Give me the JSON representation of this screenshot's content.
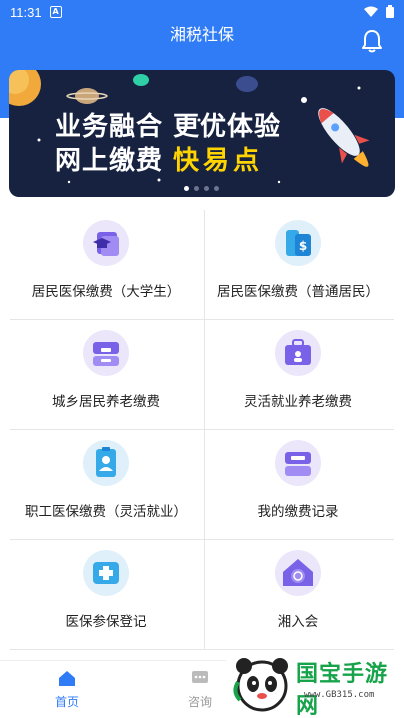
{
  "status_bar": {
    "time": "11:31",
    "notification_badge": "A"
  },
  "app_bar": {
    "title": "湘税社保",
    "bell_icon": "bell-icon"
  },
  "banner": {
    "line1": "业务融合 更优体验",
    "line2_prefix": "网上缴费",
    "line2_highlight": "快易点",
    "indicator_count": 4,
    "indicator_active": 0
  },
  "services": [
    {
      "label": "居民医保缴费（大学生）",
      "icon": "graduation-card-icon"
    },
    {
      "label": "居民医保缴费（普通居民）",
      "icon": "building-payment-icon"
    },
    {
      "label": "城乡居民养老缴费",
      "icon": "cabinet-icon"
    },
    {
      "label": "灵活就业养老缴费",
      "icon": "briefcase-icon"
    },
    {
      "label": "职工医保缴费（灵活就业）",
      "icon": "badge-person-icon"
    },
    {
      "label": "我的缴费记录",
      "icon": "record-box-icon"
    },
    {
      "label": "医保参保登记",
      "icon": "medical-plus-icon"
    },
    {
      "label": "湘入会",
      "icon": "house-icon"
    }
  ],
  "bottom_nav": {
    "home": "首页",
    "consult": "咨询"
  },
  "watermark": {
    "text": "国宝手游网",
    "url": "www.GB315.com"
  },
  "colors": {
    "primary": "#2f7cf6",
    "banner_bg": "#162240",
    "highlight": "#ffd400"
  }
}
